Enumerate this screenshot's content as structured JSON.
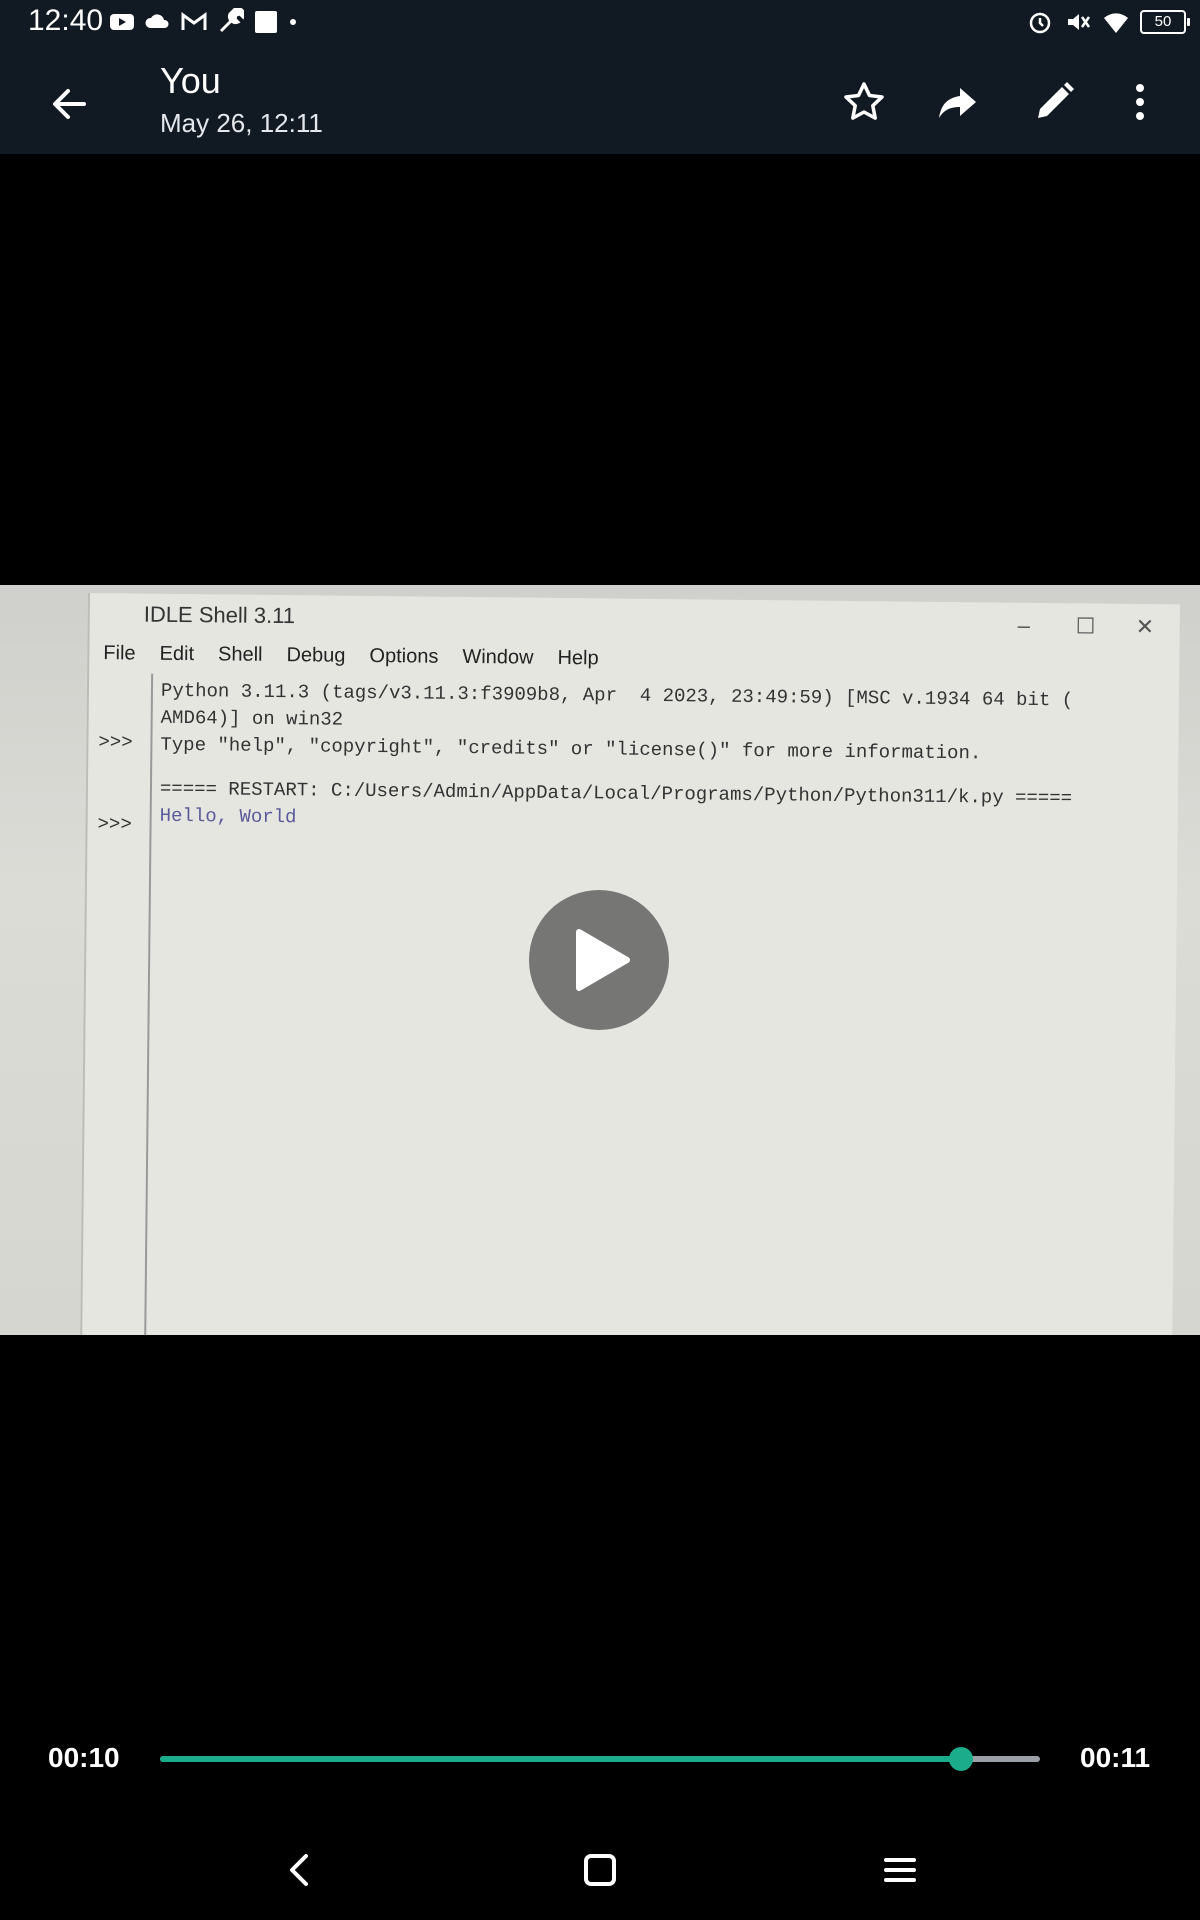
{
  "status_bar": {
    "time": "12:40",
    "battery_level": "50",
    "left_icons": [
      "youtube-icon",
      "cloud-icon",
      "gmail-icon",
      "wrench-icon",
      "square-icon",
      "dot-icon"
    ],
    "right_icons": [
      "alarm-icon",
      "mute-icon",
      "wifi-icon",
      "battery-icon"
    ]
  },
  "header": {
    "title": "You",
    "subtitle": "May 26, 12:11",
    "actions": [
      "star-icon",
      "share-icon",
      "edit-icon",
      "more-icon"
    ]
  },
  "video": {
    "idle_window": {
      "title": "IDLE Shell 3.11",
      "menus": [
        "File",
        "Edit",
        "Shell",
        "Debug",
        "Options",
        "Window",
        "Help"
      ],
      "lines": [
        "Python 3.11.3 (tags/v3.11.3:f3909b8, Apr  4 2023, 23:49:59) [MSC v.1934 64 bit (",
        "AMD64)] on win32",
        "Type \"help\", \"copyright\", \"credits\" or \"license()\" for more information.",
        "",
        "===== RESTART: C:/Users/Admin/AppData/Local/Programs/Python/Python311/k.py =====",
        "Hello, World"
      ],
      "prompts": [
        ">>>",
        ">>>"
      ]
    },
    "play_icon": "play-icon"
  },
  "player": {
    "current_time": "00:10",
    "total_time": "00:11",
    "progress": 0.91,
    "accent_color": "#1bac8c"
  },
  "nav_bar": {
    "buttons": [
      "back-nav-icon",
      "home-nav-icon",
      "menu-nav-icon"
    ]
  }
}
